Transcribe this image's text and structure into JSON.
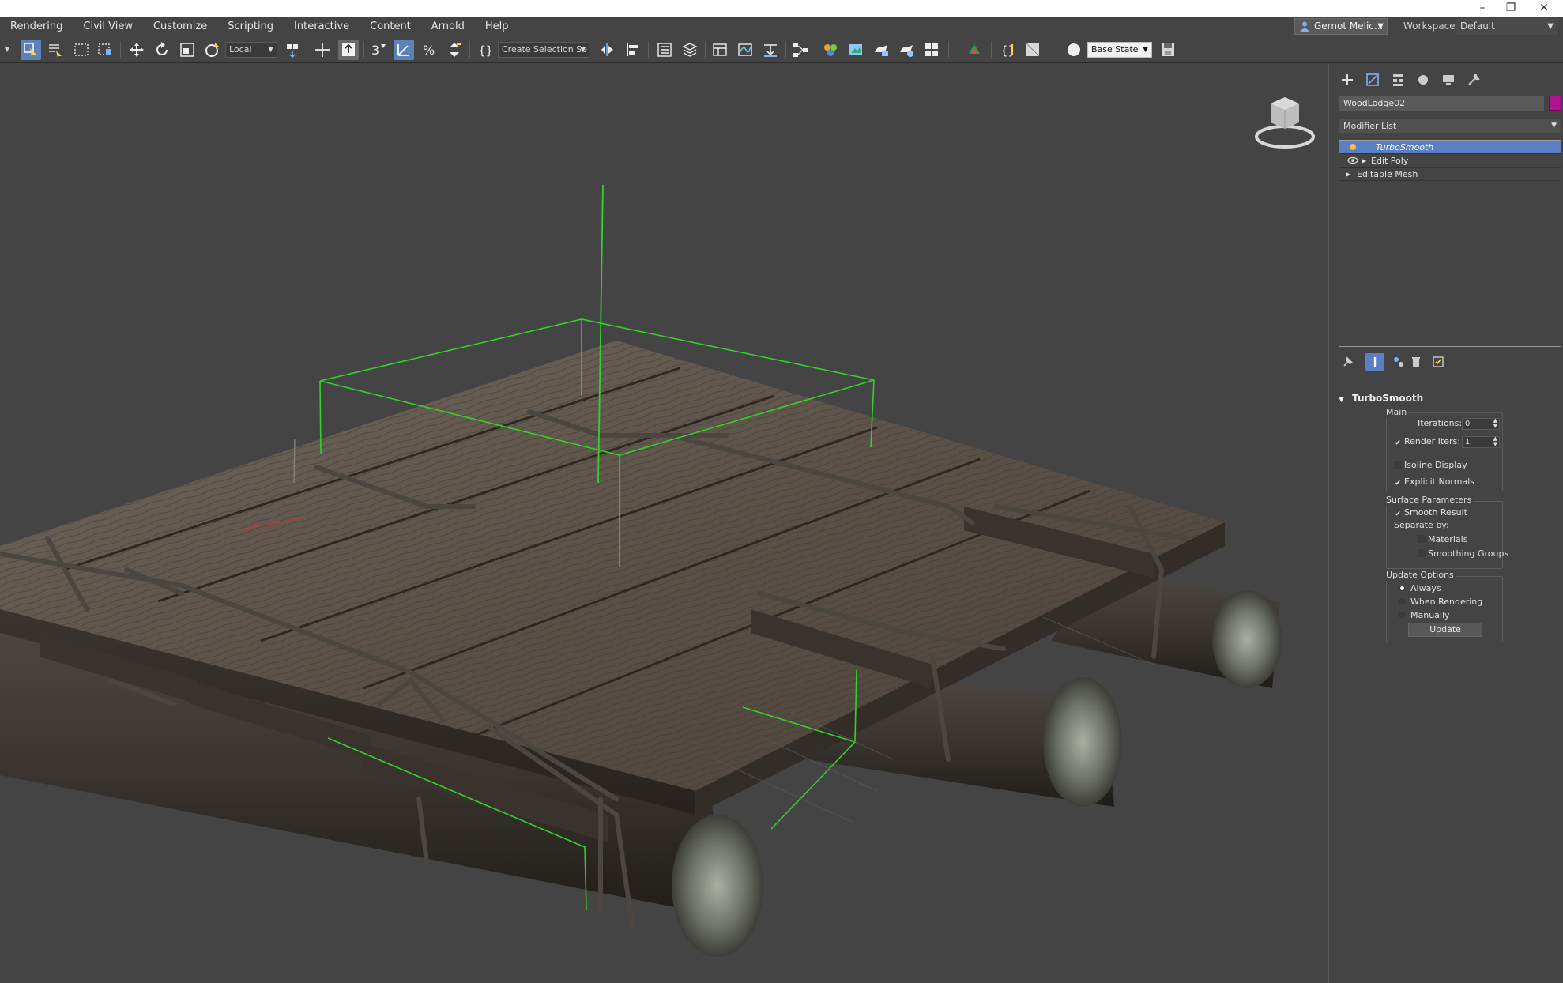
{
  "menu": [
    "Rendering",
    "Civil View",
    "Customize",
    "Scripting",
    "Interactive",
    "Content",
    "Arnold",
    "Help"
  ],
  "user": {
    "name": "Gernot Melic..."
  },
  "workspace": {
    "label": "Workspaces:",
    "value": "Default"
  },
  "toolbar": {
    "coord_system": "Local",
    "selection_set_placeholder": "Create Selection Se",
    "state_set": "Base State"
  },
  "panel": {
    "object_name": "WoodLodge02",
    "object_color": "#b0138f",
    "modifier_list_label": "Modifier List",
    "stack": [
      "TurboSmooth",
      "Edit Poly",
      "Editable Mesh"
    ],
    "rollout_title": "TurboSmooth",
    "main": {
      "title": "Main",
      "iterations_label": "Iterations:",
      "iterations_value": "0",
      "render_iters_label": "Render Iters:",
      "render_iters_value": "1",
      "isoline_label": "Isoline Display",
      "explicit_normals_label": "Explicit Normals"
    },
    "surface": {
      "title": "Surface Parameters",
      "smooth_result_label": "Smooth Result",
      "separate_by_label": "Separate by:",
      "materials_label": "Materials",
      "smoothing_groups_label": "Smoothing Groups"
    },
    "update": {
      "title": "Update Options",
      "always_label": "Always",
      "when_rendering_label": "When Rendering",
      "manually_label": "Manually",
      "button_label": "Update"
    }
  },
  "colors": {
    "viewport_bg": "#444444",
    "selection_bbox": "#33d12a",
    "highlight": "#5b7fc3"
  }
}
